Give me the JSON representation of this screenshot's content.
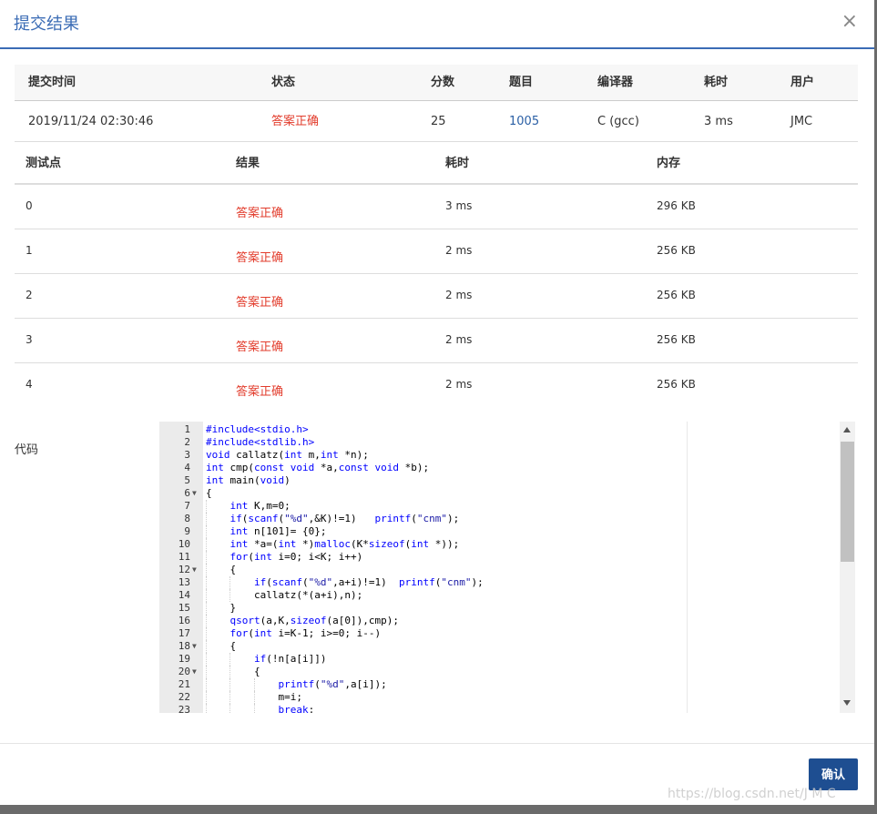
{
  "modal": {
    "title": "提交结果",
    "close": "×"
  },
  "summary": {
    "headers": [
      "提交时间",
      "状态",
      "分数",
      "题目",
      "编译器",
      "耗时",
      "用户"
    ],
    "row": {
      "time": "2019/11/24 02:30:46",
      "status": "答案正确",
      "score": "25",
      "problem": "1005",
      "compiler": "C (gcc)",
      "duration": "3 ms",
      "user": "JMC"
    }
  },
  "tests": {
    "headers": [
      "测试点",
      "结果",
      "耗时",
      "内存"
    ],
    "rows": [
      {
        "id": "0",
        "result": "答案正确",
        "time": "3 ms",
        "memory": "296 KB"
      },
      {
        "id": "1",
        "result": "答案正确",
        "time": "2 ms",
        "memory": "256 KB"
      },
      {
        "id": "2",
        "result": "答案正确",
        "time": "2 ms",
        "memory": "256 KB"
      },
      {
        "id": "3",
        "result": "答案正确",
        "time": "2 ms",
        "memory": "256 KB"
      },
      {
        "id": "4",
        "result": "答案正确",
        "time": "2 ms",
        "memory": "256 KB"
      }
    ]
  },
  "code": {
    "label": "代码",
    "lines": [
      "#include<stdio.h>",
      "#include<stdlib.h>",
      "void callatz(int m,int *n);",
      "int cmp(const void *a,const void *b);",
      "int main(void)",
      "{",
      "    int K,m=0;",
      "    if(scanf(\"%d\",&K)!=1)   printf(\"cnm\");",
      "    int n[101]= {0};",
      "    int *a=(int *)malloc(K*sizeof(int *));",
      "    for(int i=0; i<K; i++)",
      "    {",
      "        if(scanf(\"%d\",a+i)!=1)  printf(\"cnm\");",
      "        callatz(*(a+i),n);",
      "    }",
      "    qsort(a,K,sizeof(a[0]),cmp);",
      "    for(int i=K-1; i>=0; i--)",
      "    {",
      "        if(!n[a[i]])",
      "        {",
      "            printf(\"%d\",a[i]);",
      "            m=i;",
      "            break;"
    ],
    "folds": [
      6,
      12,
      18,
      20
    ]
  },
  "footer": {
    "confirm": "确认"
  },
  "watermark": "https://blog.csdn.net/J   M   C"
}
